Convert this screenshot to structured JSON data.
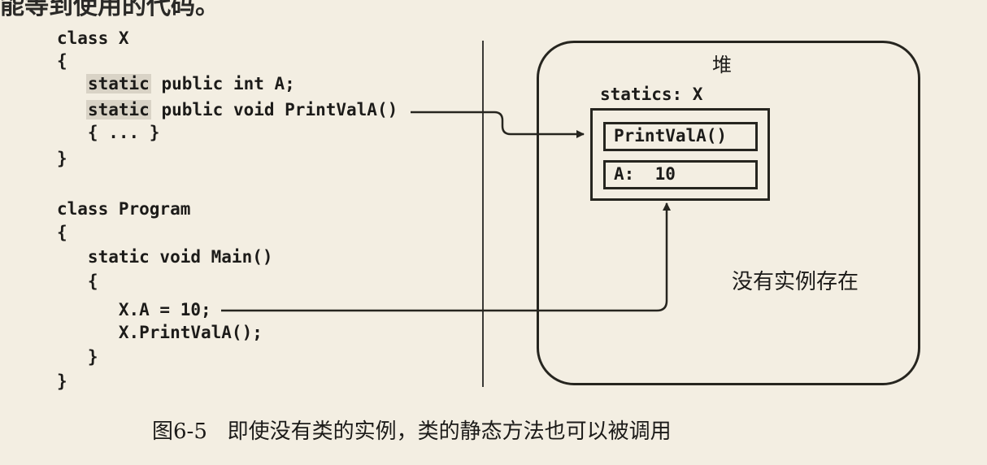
{
  "top_fragment": "能等到使用的代码。",
  "code": [
    {
      "prefix": "class X",
      "hl": "",
      "text": ""
    },
    {
      "prefix": "{",
      "hl": "",
      "text": ""
    },
    {
      "prefix": "   ",
      "hl": "static",
      "text": " public int A;"
    },
    {
      "prefix": "   ",
      "hl": "static",
      "text": " public void PrintValA()"
    },
    {
      "prefix": "   { ... }",
      "hl": "",
      "text": ""
    },
    {
      "prefix": "}",
      "hl": "",
      "text": ""
    },
    {
      "prefix": "",
      "hl": "",
      "text": ""
    },
    {
      "prefix": "class Program",
      "hl": "",
      "text": ""
    },
    {
      "prefix": "{",
      "hl": "",
      "text": ""
    },
    {
      "prefix": "   static void Main()",
      "hl": "",
      "text": ""
    },
    {
      "prefix": "   {",
      "hl": "",
      "text": ""
    },
    {
      "prefix": "      X.A = 10;",
      "hl": "",
      "text": ""
    },
    {
      "prefix": "      X.PrintValA();",
      "hl": "",
      "text": ""
    },
    {
      "prefix": "   }",
      "hl": "",
      "text": ""
    },
    {
      "prefix": "}",
      "hl": "",
      "text": ""
    }
  ],
  "heap": {
    "label": "堆",
    "statics_label": "statics: X",
    "method_member": "PrintValA()",
    "field_member": "A:  10",
    "note": "没有实例存在"
  },
  "caption": "图6-5   即使没有类的实例，类的静态方法也可以被调用",
  "colors": {
    "background": "#f3eee2",
    "ink": "#26251f",
    "highlight": "#d9d3c6"
  }
}
